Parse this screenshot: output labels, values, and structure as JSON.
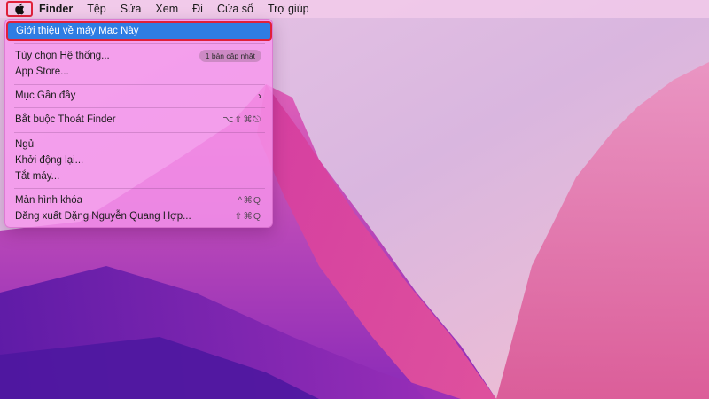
{
  "menubar": {
    "apple_icon": "apple-logo-icon",
    "items": [
      {
        "label": "Finder",
        "bold": true
      },
      {
        "label": "Tệp"
      },
      {
        "label": "Sửa"
      },
      {
        "label": "Xem"
      },
      {
        "label": "Đi"
      },
      {
        "label": "Cửa sổ"
      },
      {
        "label": "Trợ giúp"
      }
    ]
  },
  "apple_menu": {
    "about": "Giới thiệu về máy Mac Này",
    "system_prefs": "Tùy chọn Hệ thống...",
    "system_prefs_badge": "1 bản cập nhật",
    "app_store": "App Store...",
    "recent_items": "Mục Gần đây",
    "force_quit": "Bắt buộc Thoát Finder",
    "force_quit_shortcut": "⌥⇧⌘⎋",
    "sleep": "Ngủ",
    "restart": "Khởi động lại...",
    "shutdown": "Tắt máy...",
    "lock_screen": "Màn hình khóa",
    "lock_screen_shortcut": "^⌘Q",
    "logout": "Đăng xuất Đặng Nguyễn Quang Hợp...",
    "logout_shortcut": "⇧⌘Q"
  },
  "colors": {
    "highlight": "#2f7de3",
    "annotation": "#e0203a"
  }
}
